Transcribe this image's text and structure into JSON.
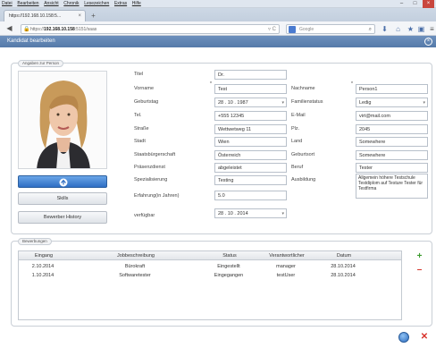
{
  "browser": {
    "menu": [
      "Datei",
      "Bearbeiten",
      "Ansicht",
      "Chronik",
      "Lesezeichen",
      "Extras",
      "Hilfe"
    ],
    "tab_title": "https://192.168.10.158:5... ",
    "tab_close": "×",
    "new_tab": "+",
    "url_host": "192.168.10.158",
    "url_prefix": "https://",
    "url_suffix": ":5151/saas",
    "search_placeholder": "Google",
    "search_engine": "g"
  },
  "app": {
    "title": "Kandidat bearbeiten"
  },
  "person": {
    "legend": "Angaben zur Person",
    "buttons": {
      "skills": "Skills",
      "history": "Bewerber History"
    },
    "fields": {
      "titel_label": "Titel",
      "titel_value": "Dr.",
      "vorname_label": "Vorname",
      "vorname_value": "Test",
      "nachname_label": "Nachname",
      "nachname_value": "Person1",
      "geburtstag_label": "Geburtstag",
      "geburtstag_value": "28 . 10 . 1987",
      "familienstatus_label": "Familienstatus",
      "familienstatus_value": "Ledig",
      "tel_label": "Tel.",
      "tel_value": "+555 12345",
      "email_label": "E-Mail",
      "email_value": "virt@mail.com",
      "strasse_label": "Straße",
      "strasse_value": "Wettwetweg 11",
      "plz_label": "Plz.",
      "plz_value": "2045",
      "stadt_label": "Stadt",
      "stadt_value": "Wien",
      "land_label": "Land",
      "land_value": "Somewhere",
      "staatsbuergerschaft_label": "Staatsbürgerschaft",
      "staatsbuergerschaft_value": "Österreich",
      "geburtsort_label": "Geburtsort",
      "geburtsort_value": "Somewhere",
      "praesenzdienst_label": "Präsenzdienst",
      "praesenzdienst_value": "abgeleistet",
      "beruf_label": "Beruf",
      "beruf_value": "Tester",
      "spezialisierung_label": "Spezialisierung",
      "spezialisierung_value": "Testing",
      "ausbildung_label": "Ausbildung",
      "ausbildung_value": "Allgemein höhere Testschule Testdiplom auf Testure Tester für Testfirma",
      "erfahrung_label": "Erfahrung(in Jahren)",
      "erfahrung_value": "5.0",
      "verfuegbar_label": "verfügbar",
      "verfuegbar_value": "28 . 10 . 2014"
    }
  },
  "bewerbungen": {
    "legend": "Bewerbungen",
    "columns": [
      "Eingang",
      "Jobbeschreibung",
      "Status",
      "Verantwortlicher",
      "Datum"
    ],
    "rows": [
      [
        "2.10.2014",
        "Bürokraft",
        "Eingestellt",
        "manager",
        "28.10.2014"
      ],
      [
        "1.10.2014",
        "Softwaretester",
        "Eingegangen",
        "testUser",
        "28.10.2014"
      ]
    ]
  },
  "colors": {
    "appbar": "#557aa9",
    "add": "#3c9b2e",
    "remove": "#d5352b"
  }
}
